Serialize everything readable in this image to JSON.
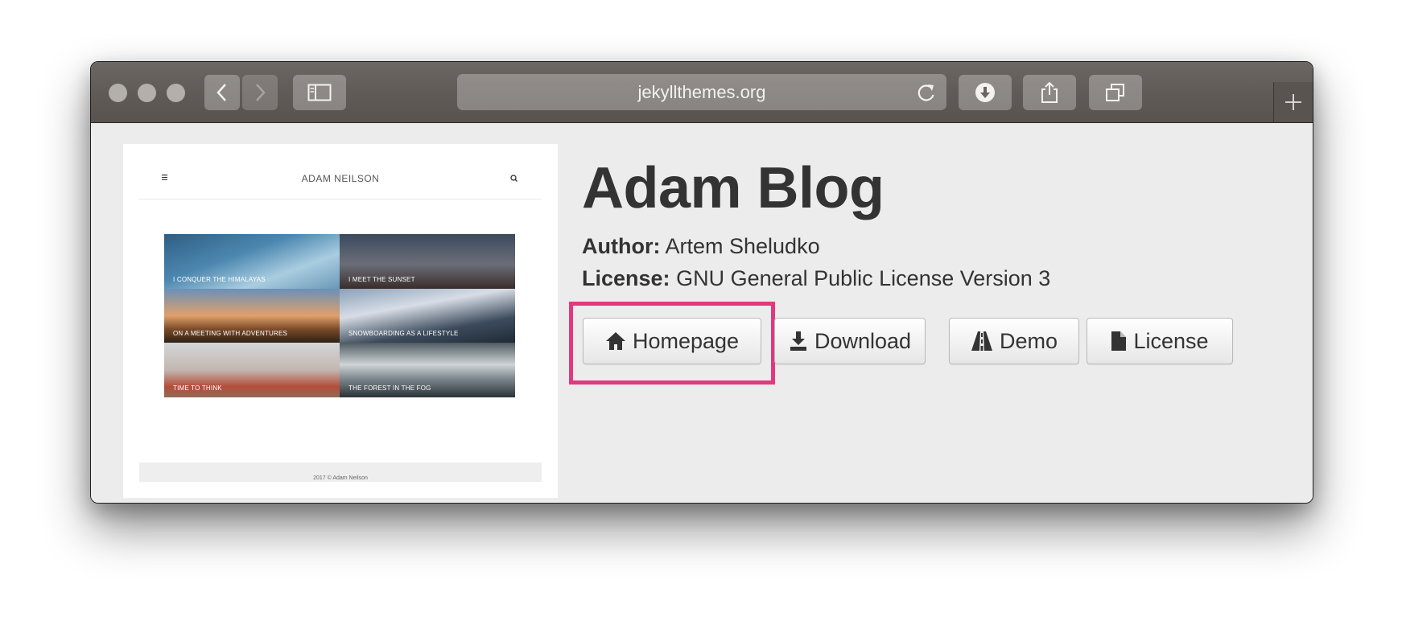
{
  "browser": {
    "url": "jekyllthemes.org",
    "icons": {
      "back": "chevron-left-icon",
      "forward": "chevron-right-icon",
      "sidebar": "sidebar-icon",
      "reload": "reload-icon",
      "downloads": "download-icon",
      "share": "share-icon",
      "tabs": "tabs-icon",
      "new_tab": "plus-icon"
    }
  },
  "theme": {
    "title": "Adam Blog",
    "author_label": "Author:",
    "author": "Artem Sheludko",
    "license_label": "License:",
    "license": "GNU General Public License Version 3"
  },
  "preview": {
    "brand": "ADAM NEILSON",
    "posts": [
      "I conquer the Himalayas",
      "I meet the sunset",
      "On a meeting with adventures",
      "Snowboarding as a lifestyle",
      "Time to think",
      "The forest in the fog"
    ],
    "footer": "2017 © Adam Neilson"
  },
  "buttons": [
    {
      "label": "Homepage",
      "icon": "home-icon"
    },
    {
      "label": "Download",
      "icon": "download-icon"
    },
    {
      "label": "Demo",
      "icon": "road-icon"
    },
    {
      "label": "License",
      "icon": "file-icon"
    }
  ],
  "highlight_color": "#e0397c"
}
